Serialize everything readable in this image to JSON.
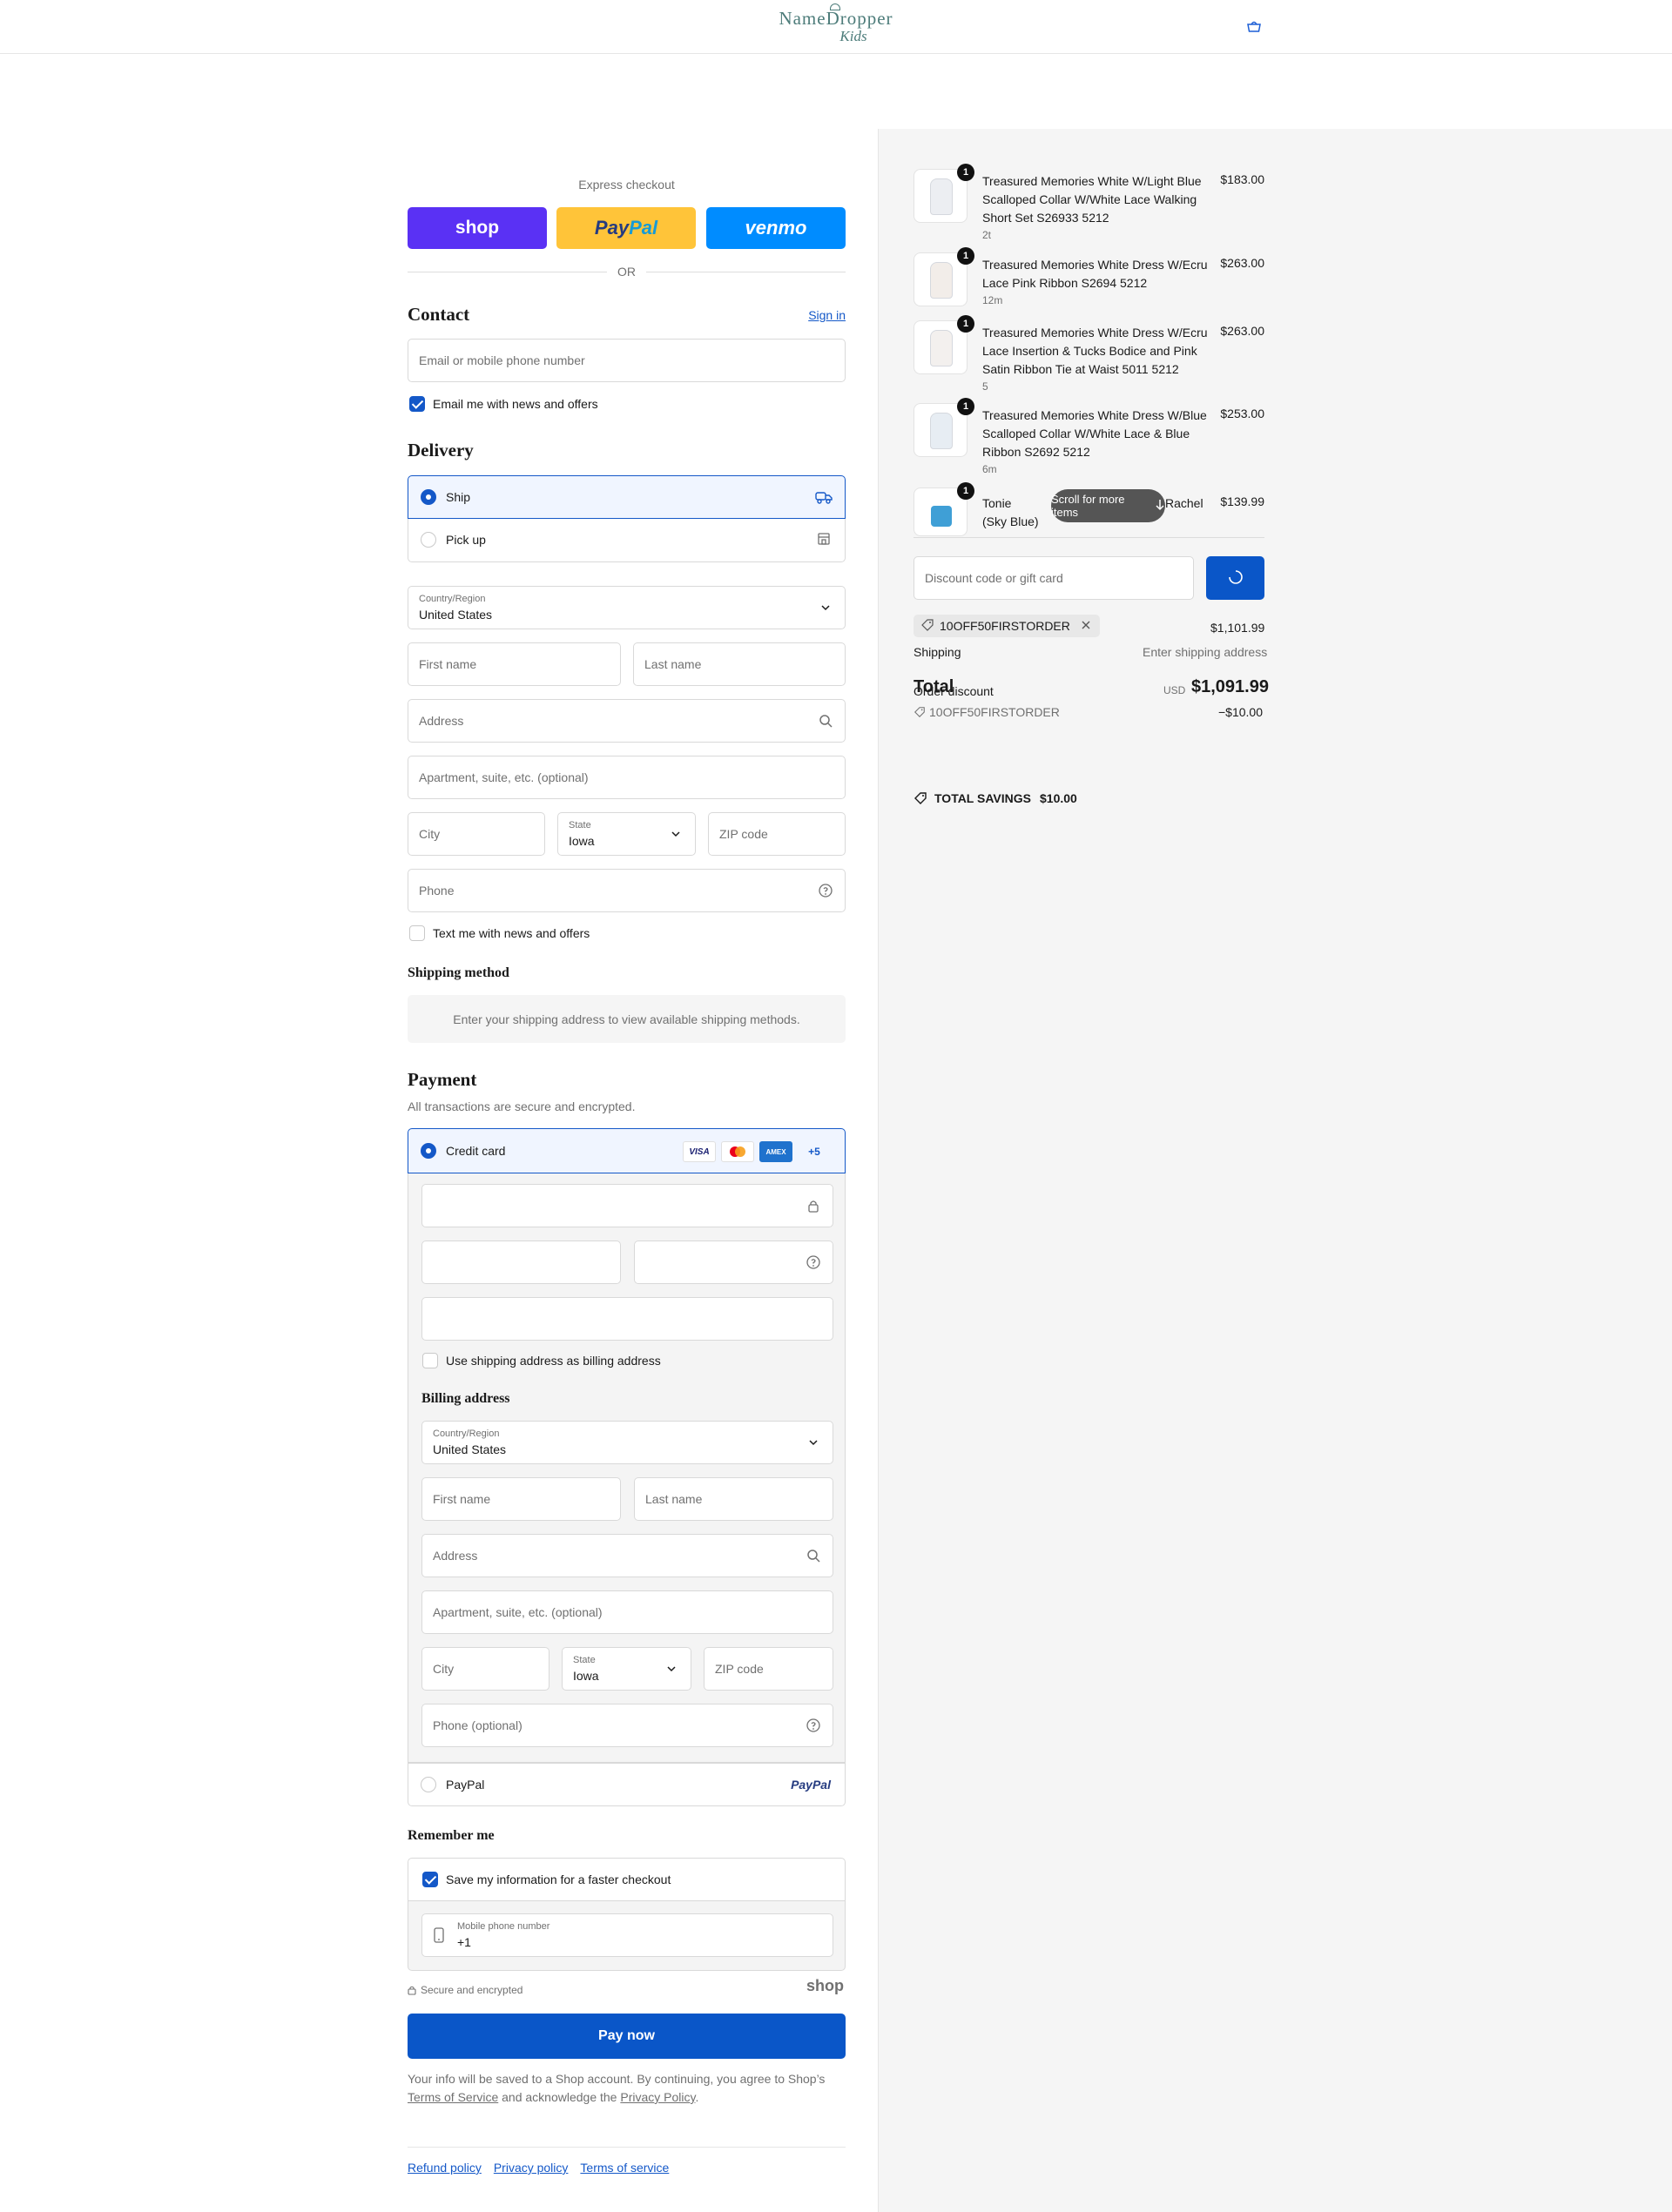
{
  "header": {
    "logo_line1": "NameDropper",
    "logo_line2": "Kids",
    "bag_icon": "shopping-bag-icon"
  },
  "express": {
    "label": "Express checkout",
    "shop": "shop",
    "paypal_a": "Pay",
    "paypal_b": "Pal",
    "venmo": "venmo",
    "or": "OR"
  },
  "contact": {
    "title": "Contact",
    "sign_in": "Sign in",
    "email_placeholder": "Email or mobile phone number",
    "email_offers": "Email me with news and offers"
  },
  "delivery": {
    "title": "Delivery",
    "ship": "Ship",
    "pickup": "Pick up",
    "country_label": "Country/Region",
    "country_value": "United States",
    "first_name": "First name",
    "last_name": "Last name",
    "address": "Address",
    "apartment": "Apartment, suite, etc. (optional)",
    "city": "City",
    "state_label": "State",
    "state_value": "Iowa",
    "zip": "ZIP code",
    "phone": "Phone",
    "text_offers": "Text me with news and offers"
  },
  "shipping_method": {
    "title": "Shipping method",
    "notice": "Enter your shipping address to view available shipping methods."
  },
  "payment": {
    "title": "Payment",
    "subtitle": "All transactions are secure and encrypted.",
    "credit_card": "Credit card",
    "logos": {
      "visa": "VISA",
      "amex": "AMEX",
      "more": "+5"
    },
    "use_shipping": "Use shipping address as billing address",
    "billing_title": "Billing address",
    "billing": {
      "country_label": "Country/Region",
      "country_value": "United States",
      "first_name": "First name",
      "last_name": "Last name",
      "address": "Address",
      "apartment": "Apartment, suite, etc. (optional)",
      "city": "City",
      "state_label": "State",
      "state_value": "Iowa",
      "zip": "ZIP code",
      "phone": "Phone (optional)"
    },
    "paypal": "PayPal",
    "paypal_logo": "PayPal"
  },
  "remember": {
    "title": "Remember me",
    "save": "Save my information for a faster checkout",
    "mobile_label": "Mobile phone number",
    "mobile_value": "+1"
  },
  "secure": {
    "text": "Secure and encrypted",
    "shop": "shop"
  },
  "pay_now": "Pay now",
  "legal": {
    "text1": "Your info will be saved to a Shop account. By continuing, you agree to Shop’s",
    "terms": "Terms of Service",
    "text2": "and acknowledge the",
    "privacy": "Privacy Policy",
    "period": "."
  },
  "footer": {
    "refund": "Refund policy",
    "privacy": "Privacy policy",
    "terms": "Terms of service"
  },
  "cart": {
    "items": [
      {
        "qty": "1",
        "name": "Treasured Memories White W/Light Blue Scalloped Collar W/White Lace Walking Short Set S26933 5212",
        "variant": "2t",
        "price": "$183.00"
      },
      {
        "qty": "1",
        "name": "Treasured Memories White Dress W/Ecru Lace Pink Ribbon S2694 5212",
        "variant": "12m",
        "price": "$263.00"
      },
      {
        "qty": "1",
        "name": "Treasured Memories White Dress W/Ecru Lace Insertion & Tucks Bodice and Pink Satin Ribbon Tie at Waist 5011 5212",
        "variant": "5",
        "price": "$263.00"
      },
      {
        "qty": "1",
        "name": "Treasured Memories White Dress W/Blue Scalloped Collar W/White Lace & Blue Ribbon S2692 5212",
        "variant": "6m",
        "price": "$253.00"
      },
      {
        "qty": "1",
        "name_a": "Tonie",
        "name_b": "Rachel",
        "name_c": "(Sky Blue)",
        "price": "$139.99"
      }
    ],
    "scroll_hint": "Scroll for more items",
    "discount_placeholder": "Discount code or gift card",
    "code": "10OFF50FIRSTORDER",
    "subtotal_value": "$1,101.99",
    "shipping_label": "Shipping",
    "shipping_value": "Enter shipping address",
    "total_label": "Total",
    "order_discount": "Order discount",
    "discount_code": "10OFF50FIRSTORDER",
    "discount_value": "−$10.00",
    "currency": "USD",
    "total_value": "$1,091.99",
    "savings_label": "TOTAL SAVINGS",
    "savings_value": "$10.00"
  }
}
